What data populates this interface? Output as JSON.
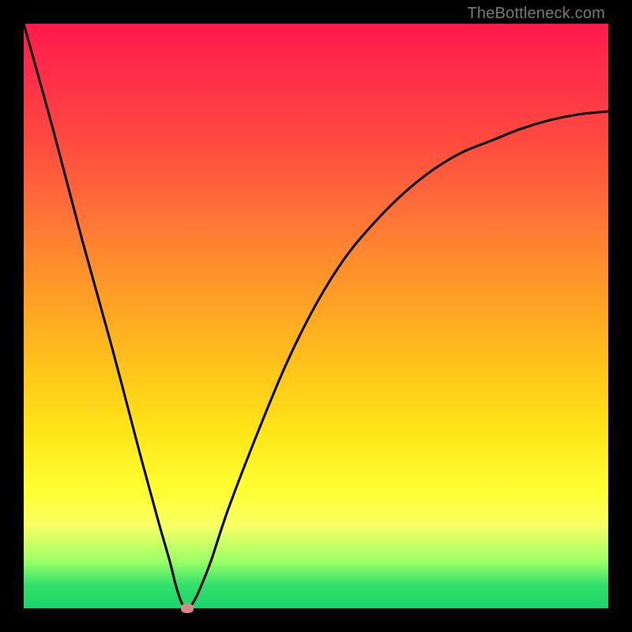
{
  "watermark": {
    "text": "TheBottleneck.com"
  },
  "chart_data": {
    "type": "line",
    "title": "",
    "xlabel": "",
    "ylabel": "",
    "xlim": [
      0,
      100
    ],
    "ylim": [
      0,
      100
    ],
    "series": [
      {
        "name": "bottleneck-curve",
        "x": [
          0,
          5,
          10,
          15,
          20,
          23,
          25,
          26,
          27,
          28,
          29,
          30,
          32,
          35,
          40,
          45,
          50,
          55,
          60,
          65,
          70,
          75,
          80,
          85,
          90,
          95,
          100
        ],
        "y": [
          100,
          82,
          63,
          45,
          26,
          15,
          8,
          4,
          1,
          0,
          1,
          3,
          8,
          17,
          30,
          42,
          52,
          60,
          66,
          71,
          75,
          78,
          80,
          82,
          83.5,
          84.5,
          85
        ]
      }
    ],
    "marker": {
      "x": 28,
      "y": 0
    },
    "background_gradient": {
      "stops": [
        {
          "pos": 0,
          "color": "#ff1a4b"
        },
        {
          "pos": 20,
          "color": "#ff4a3f"
        },
        {
          "pos": 40,
          "color": "#ff8a2e"
        },
        {
          "pos": 60,
          "color": "#ffc71a"
        },
        {
          "pos": 80,
          "color": "#ffff33"
        },
        {
          "pos": 92,
          "color": "#99ff66"
        },
        {
          "pos": 100,
          "color": "#1bd46a"
        }
      ]
    }
  }
}
